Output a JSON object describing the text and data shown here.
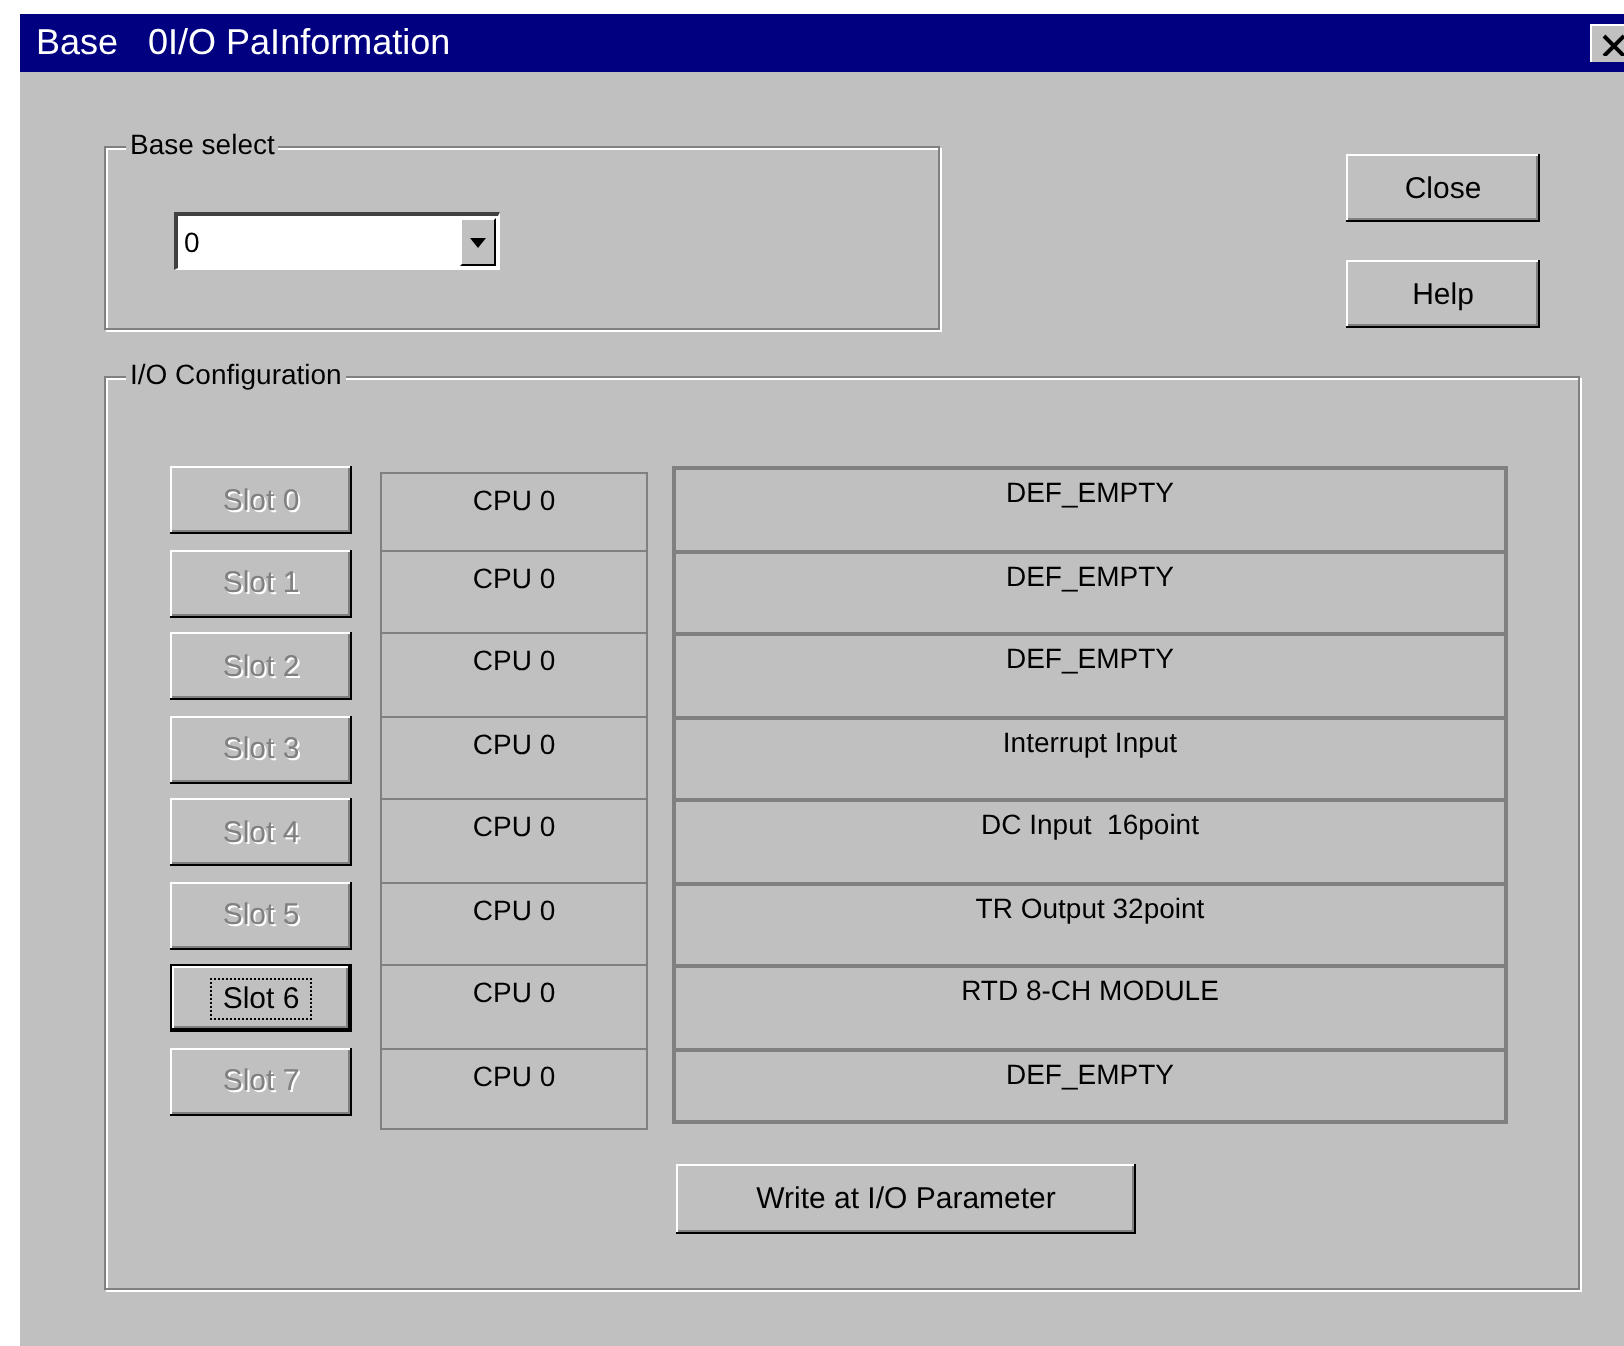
{
  "window": {
    "title": "Base   0I/O PaInformation"
  },
  "base_select": {
    "label": "Base select",
    "value": "0"
  },
  "buttons": [
    {
      "label": "Close"
    },
    {
      "label": "Help"
    }
  ],
  "io_configuration": {
    "label": "I/O Configuration",
    "slots": [
      {
        "label": "Slot 0",
        "disabled": true,
        "selected": false,
        "cpu": "CPU 0",
        "module": "DEF_EMPTY"
      },
      {
        "label": "Slot 1",
        "disabled": true,
        "selected": false,
        "cpu": "CPU 0",
        "module": "DEF_EMPTY"
      },
      {
        "label": "Slot 2",
        "disabled": true,
        "selected": false,
        "cpu": "CPU 0",
        "module": "DEF_EMPTY"
      },
      {
        "label": "Slot 3",
        "disabled": true,
        "selected": false,
        "cpu": "CPU 0",
        "module": "Interrupt Input"
      },
      {
        "label": "Slot 4",
        "disabled": true,
        "selected": false,
        "cpu": "CPU 0",
        "module": "DC Input  16point"
      },
      {
        "label": "Slot 5",
        "disabled": true,
        "selected": false,
        "cpu": "CPU 0",
        "module": "TR Output 32point"
      },
      {
        "label": "Slot 6",
        "disabled": false,
        "selected": true,
        "cpu": "CPU 0",
        "module": "RTD 8-CH MODULE"
      },
      {
        "label": "Slot 7",
        "disabled": true,
        "selected": false,
        "cpu": "CPU 0",
        "module": "DEF_EMPTY"
      }
    ],
    "write_button": "Write at I/O Parameter"
  }
}
